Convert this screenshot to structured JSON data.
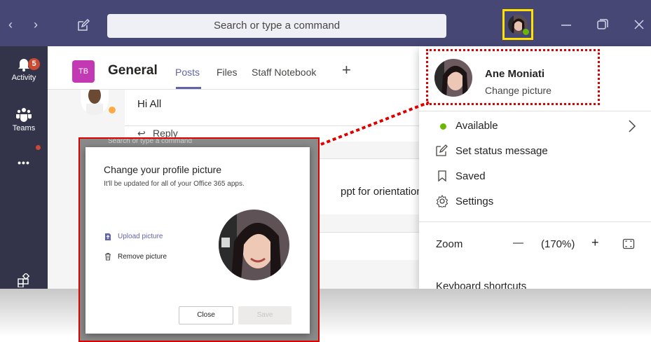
{
  "titlebar": {
    "back_glyph": "‹",
    "forward_glyph": "›",
    "search_placeholder": "Search or type a command"
  },
  "rail": {
    "activity_label": "Activity",
    "activity_badge": "5",
    "teams_label": "Teams",
    "more_glyph": "•••"
  },
  "channel": {
    "team_initials": "TB",
    "name": "General",
    "tabs": [
      {
        "label": "Posts"
      },
      {
        "label": "Files"
      },
      {
        "label": "Staff Notebook"
      }
    ],
    "add_tab_glyph": "+"
  },
  "post": {
    "message": "Hi All",
    "reply_label": "Reply",
    "second_message_fragment": "ppt for orientation i",
    "behind_search_fragment": "Search or type a command"
  },
  "profile_menu": {
    "user_name": "Ane Moniati",
    "change_picture": "Change picture",
    "available": "Available",
    "set_status": "Set status message",
    "saved": "Saved",
    "settings": "Settings",
    "zoom_label": "Zoom",
    "zoom_minus": "—",
    "zoom_value": "(170%)",
    "zoom_plus": "+",
    "keyboard_shortcuts": "Keyboard shortcuts"
  },
  "dialog": {
    "title": "Change your profile picture",
    "subtitle": "It'll be updated for all of your Office 365 apps.",
    "upload": "Upload picture",
    "remove": "Remove picture",
    "close": "Close",
    "save": "Save"
  },
  "colors": {
    "titlebar": "#464775",
    "rail": "#33344a",
    "accent": "#6264a7",
    "highlight_yellow": "#ffe100",
    "annotation_red": "#e00000",
    "available_green": "#6bb700"
  }
}
